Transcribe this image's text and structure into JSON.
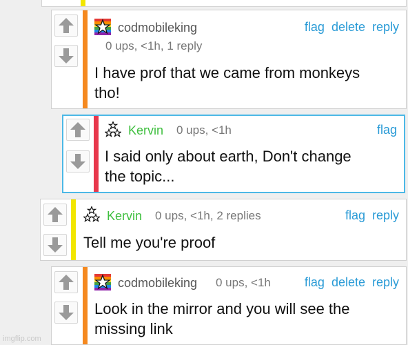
{
  "colors": {
    "orange": "#f5891f",
    "red": "#e8384c",
    "yellow": "#f2e600",
    "link": "#2a9bd6",
    "green_user": "#3fbf3f",
    "highlight": "#4cb8e6"
  },
  "icons": {
    "upvote": "arrow-up-icon",
    "downvote": "arrow-down-icon"
  },
  "comments": [
    {
      "username": "codmobileking",
      "meta": "0 ups, <1h, 1 reply",
      "actions": [
        "flag",
        "delete",
        "reply"
      ],
      "text_lines": [
        "I have prof that we came from monkeys",
        "tho!"
      ]
    },
    {
      "username": "Kervin",
      "meta": "0 ups, <1h",
      "actions": [
        "flag"
      ],
      "text_lines": [
        "I said only about earth, Don't change",
        "the topic..."
      ]
    },
    {
      "username": "Kervin",
      "meta": "0 ups, <1h, 2 replies",
      "actions": [
        "flag",
        "reply"
      ],
      "text_lines": [
        "Tell me you're proof"
      ]
    },
    {
      "username": "codmobileking",
      "meta": "0 ups, <1h",
      "actions": [
        "flag",
        "delete",
        "reply"
      ],
      "text_lines": [
        "Look in the mirror and you will see the",
        "missing link"
      ]
    }
  ],
  "watermark": "imgflip.com"
}
